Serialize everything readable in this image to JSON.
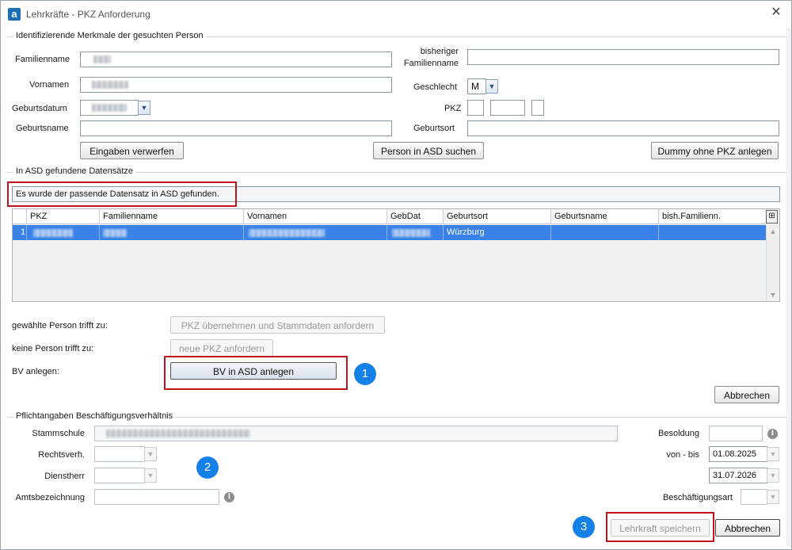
{
  "window": {
    "title": "Lehrkräfte - PKZ Anforderung",
    "app_icon": "a",
    "close_glyph": "✕"
  },
  "search_group": {
    "title": "Identifizierende Merkmale der gesuchten Person",
    "familienname_label": "Familienname",
    "bisheriger_label_1": "bisheriger",
    "bisheriger_label_2": "Familienname",
    "vornamen_label": "Vornamen",
    "geschlecht_label": "Geschlecht",
    "geschlecht_value": "M",
    "geburtsdatum_label": "Geburtsdatum",
    "pkz_label": "PKZ",
    "geburtsname_label": "Geburtsname",
    "geburtsort_label": "Geburtsort",
    "btn_discard": "Eingaben verwerfen",
    "btn_search": "Person in ASD suchen",
    "btn_dummy": "Dummy ohne PKZ anlegen"
  },
  "results_group": {
    "title": "In ASD gefundene Datensätze",
    "status": "Es wurde der passende Datensatz in ASD gefunden.",
    "columns": [
      "PKZ",
      "Familienname",
      "Vornamen",
      "GebDat",
      "Geburtsort",
      "Geburtsname",
      "bish.Familienn."
    ],
    "rows": [
      {
        "index": "1",
        "geburtsort": "Würzburg"
      }
    ],
    "column_chooser_icon": "column-chooser-icon"
  },
  "actions": {
    "trifft_zu_label": "gewählte Person trifft zu:",
    "btn_pkz_uebernehmen": "PKZ übernehmen und Stammdaten anfordern",
    "keine_person_label": "keine Person trifft zu:",
    "btn_neue_pkz": "neue PKZ anfordern",
    "bv_label": "BV anlegen:",
    "btn_bv_anlegen": "BV in ASD anlegen",
    "btn_abbrechen_1": "Abbrechen"
  },
  "employment_group": {
    "title": "Pflichtangaben Beschäftigungsverhältnis",
    "stammschule_label": "Stammschule",
    "besoldung_label": "Besoldung",
    "rechtsverh_label": "Rechtsverh.",
    "von_bis_label": "von - bis",
    "von_value": "01.08.2025",
    "bis_value": "31.07.2026",
    "dienstherr_label": "Dienstherr",
    "amtsbezeichnung_label": "Amtsbezeichnung",
    "beschaeftigungsart_label": "Beschäftigungsart",
    "btn_speichern": "Lehrkraft speichern",
    "btn_abbrechen_2": "Abbrechen"
  },
  "badges": {
    "one": "1",
    "two": "2",
    "three": "3"
  },
  "colors": {
    "accent": "#1580e8",
    "highlight_red": "#c0141c",
    "row_selected": "#3b82e8"
  }
}
